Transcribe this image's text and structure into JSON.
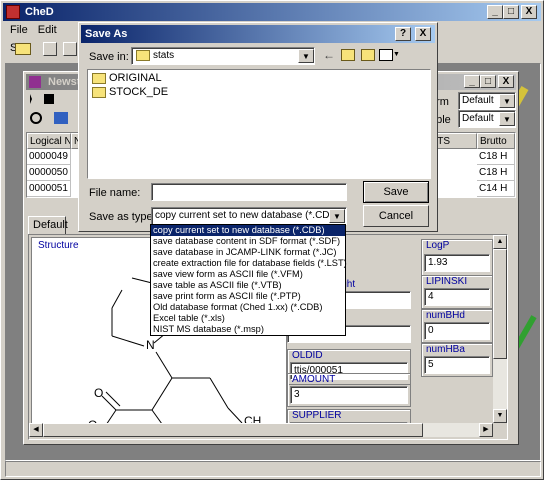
{
  "app": {
    "title": "CheD",
    "menu": [
      "File",
      "Edit",
      "Sea"
    ],
    "window_buttons": [
      "_",
      "□",
      "X"
    ]
  },
  "child_window": {
    "title": "Newsto",
    "window_buttons": [
      "_",
      "□",
      "X"
    ],
    "form_label": "orm",
    "form_value": "Default",
    "table_label": "able",
    "table_value": "Default",
    "columns": [
      "Logical N.",
      "N",
      "NTS",
      "Brutto"
    ],
    "rows": [
      {
        "logical": "0000049",
        "brutto": "C18 H"
      },
      {
        "logical": "0000050",
        "brutto": "C18 H"
      },
      {
        "logical": "0000051",
        "brutto": "C14 H"
      }
    ],
    "tab": "Default"
  },
  "form": {
    "structure_label": "Structure",
    "atom_labels": [
      "O",
      "N",
      "O",
      "O",
      "CH",
      "3"
    ],
    "partial_labels": [
      "a",
      "ight",
      "3"
    ],
    "oldid": {
      "label": "OLDID",
      "value": "ttis/000051"
    },
    "amount": {
      "label": "AMOUNT",
      "value": "3"
    },
    "supplier": {
      "label": "SUPPLIER",
      "value": ""
    },
    "logp": {
      "label": "LogP",
      "value": "1.93"
    },
    "lipinski": {
      "label": "LIPINSKI",
      "value": "4"
    },
    "numbhd": {
      "label": "numBHd",
      "value": "0"
    },
    "numbha": {
      "label": "numHBa",
      "value": "5"
    }
  },
  "dialog": {
    "title": "Save As",
    "help_button": "?",
    "close_button": "X",
    "save_in_label": "Save in:",
    "save_in_value": "stats",
    "folders": [
      "ORIGINAL",
      "STOCK_DE"
    ],
    "file_name_label": "File name:",
    "file_name_value": "",
    "save_as_type_label": "Save as type:",
    "save_as_type_value": "copy current set to new database (*.CDB)",
    "save_button": "Save",
    "cancel_button": "Cancel",
    "type_options": [
      "copy current set to new database (*.CDB)",
      "save database content in SDF format (*.SDF)",
      "save database in JCAMP-LINK format (*.JC)",
      "create extraction file for database fields (*.LST)",
      "save view form as ASCII file (*.VFM)",
      "save table as ASCII file (*.VTB)",
      "save print form as ASCII file (*.PTP)",
      "Old database format (Ched 1.xx) (*.CDB)",
      "Excel table (*.xls)",
      "NIST MS database (*.msp)"
    ],
    "selected_option_index": 0
  },
  "icons": [
    "app-icon",
    "folder-open-icon",
    "back-arrow-icon",
    "up-folder-icon",
    "new-folder-icon",
    "view-menu-icon",
    "first-record-icon",
    "prev-record-icon",
    "target-icon",
    "edit-icon"
  ]
}
